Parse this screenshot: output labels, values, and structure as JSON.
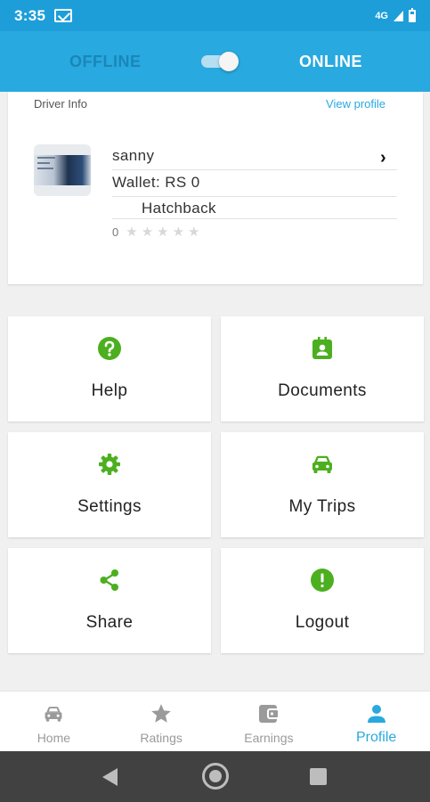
{
  "status_bar": {
    "time": "3:35",
    "network": "4G"
  },
  "header": {
    "offline_label": "OFFLINE",
    "online_label": "ONLINE",
    "online": true
  },
  "driver": {
    "section_title": "Driver Info",
    "view_profile_label": "View profile",
    "name": "sanny",
    "wallet": "Wallet: RS 0",
    "vehicle": "Hatchback",
    "rating_value": "0",
    "rating_stars_filled": 0,
    "rating_stars_total": 5
  },
  "tiles": [
    {
      "label": "Help",
      "icon": "help-icon"
    },
    {
      "label": "Documents",
      "icon": "documents-icon"
    },
    {
      "label": "Settings",
      "icon": "settings-icon"
    },
    {
      "label": "My Trips",
      "icon": "car-icon"
    },
    {
      "label": "Share",
      "icon": "share-icon"
    },
    {
      "label": "Logout",
      "icon": "logout-icon"
    }
  ],
  "bottom_nav": {
    "items": [
      {
        "label": "Home",
        "icon": "car-icon"
      },
      {
        "label": "Ratings",
        "icon": "star-icon"
      },
      {
        "label": "Earnings",
        "icon": "wallet-icon"
      },
      {
        "label": "Profile",
        "icon": "person-icon"
      }
    ],
    "active": "Profile"
  },
  "colors": {
    "primary": "#28a9df",
    "accent": "#4caf1f",
    "nav_inactive": "#9a9a9a",
    "system_nav": "#414141"
  }
}
